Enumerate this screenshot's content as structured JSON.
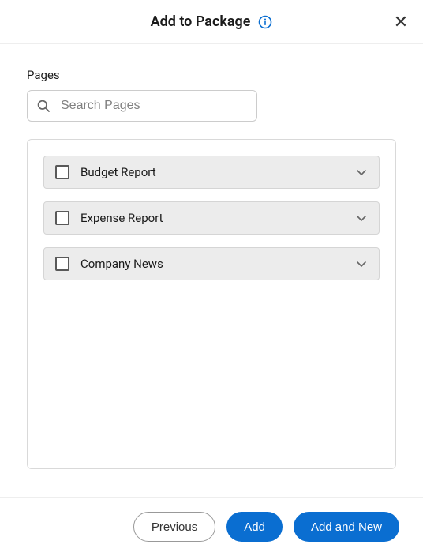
{
  "header": {
    "title": "Add to Package"
  },
  "pages": {
    "label": "Pages",
    "search_placeholder": "Search Pages",
    "items": [
      {
        "label": "Budget Report"
      },
      {
        "label": "Expense Report"
      },
      {
        "label": "Company News"
      }
    ]
  },
  "footer": {
    "previous": "Previous",
    "add": "Add",
    "add_and_new": "Add and New"
  },
  "colors": {
    "primary": "#0a6ed1",
    "info": "#0a6ed1"
  }
}
